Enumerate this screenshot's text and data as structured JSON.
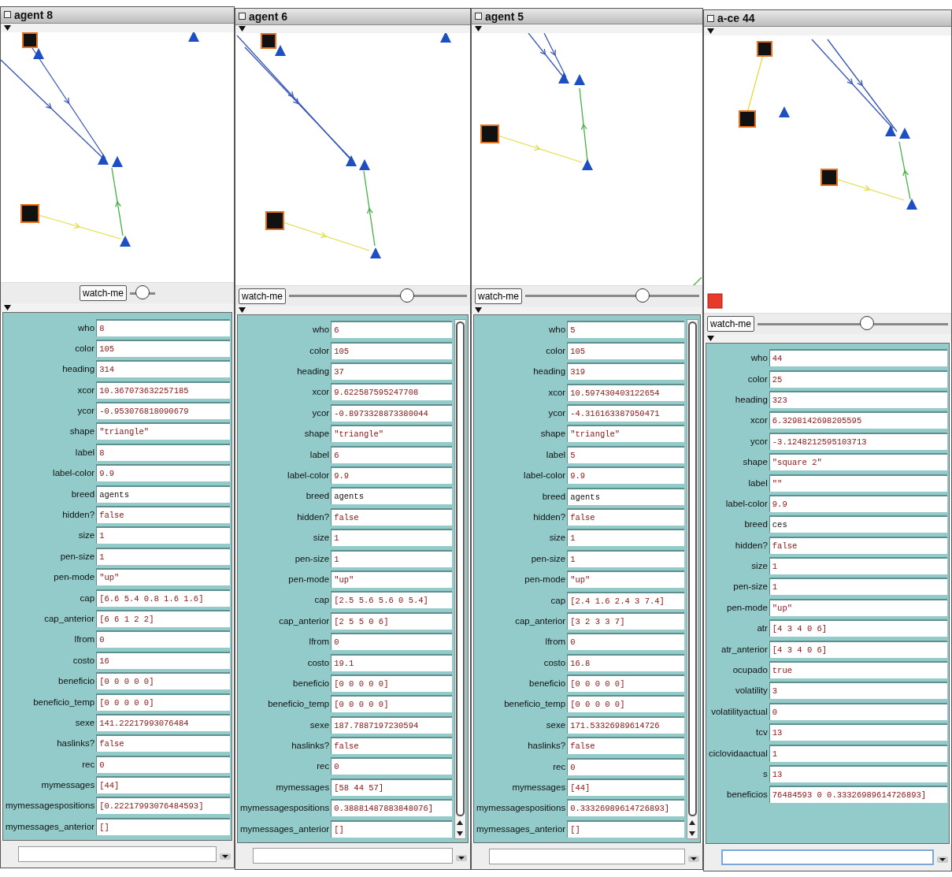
{
  "windows": [
    {
      "title": "agent 8",
      "watch_button": "watch-me",
      "slider": {
        "level": 0.5
      },
      "scrollable": false,
      "focused": false,
      "properties": [
        {
          "label": "who",
          "value": "8",
          "kind": "value"
        },
        {
          "label": "color",
          "value": "105",
          "kind": "value"
        },
        {
          "label": "heading",
          "value": "314",
          "kind": "value"
        },
        {
          "label": "xcor",
          "value": "10.367073632257185",
          "kind": "value"
        },
        {
          "label": "ycor",
          "value": "-0.953076818090679",
          "kind": "value"
        },
        {
          "label": "shape",
          "value": "\"triangle\"",
          "kind": "value"
        },
        {
          "label": "label",
          "value": "8",
          "kind": "value"
        },
        {
          "label": "label-color",
          "value": "9.9",
          "kind": "value"
        },
        {
          "label": "breed",
          "value": "agents",
          "kind": "breed"
        },
        {
          "label": "hidden?",
          "value": "false",
          "kind": "value"
        },
        {
          "label": "size",
          "value": "1",
          "kind": "value"
        },
        {
          "label": "pen-size",
          "value": "1",
          "kind": "value"
        },
        {
          "label": "pen-mode",
          "value": "\"up\"",
          "kind": "value"
        },
        {
          "label": "cap",
          "value": "[6.6 5.4 0.8 1.6 1.6]",
          "kind": "value"
        },
        {
          "label": "cap_anterior",
          "value": "[6 6 1 2 2]",
          "kind": "value"
        },
        {
          "label": "lfrom",
          "value": "0",
          "kind": "value"
        },
        {
          "label": "costo",
          "value": "16",
          "kind": "value"
        },
        {
          "label": "beneficio",
          "value": "[0 0 0 0 0]",
          "kind": "value"
        },
        {
          "label": "beneficio_temp",
          "value": "[0 0 0 0 0]",
          "kind": "value"
        },
        {
          "label": "sexe",
          "value": "141.22217993076484",
          "kind": "value"
        },
        {
          "label": "haslinks?",
          "value": "false",
          "kind": "value"
        },
        {
          "label": "rec",
          "value": "0",
          "kind": "value"
        },
        {
          "label": "mymessages",
          "value": "[44]",
          "kind": "value"
        },
        {
          "label": "mymessagespositions",
          "value": "[0.22217993076484593]",
          "kind": "value"
        },
        {
          "label": "mymessages_anterior",
          "value": "[]",
          "kind": "value"
        }
      ]
    },
    {
      "title": "agent 6",
      "watch_button": "watch-me",
      "slider": {
        "level": 0.68
      },
      "scrollable": true,
      "focused": false,
      "properties": [
        {
          "label": "who",
          "value": "6",
          "kind": "value"
        },
        {
          "label": "color",
          "value": "105",
          "kind": "value"
        },
        {
          "label": "heading",
          "value": "37",
          "kind": "value"
        },
        {
          "label": "xcor",
          "value": "9.622587595247708",
          "kind": "value"
        },
        {
          "label": "ycor",
          "value": "-0.8973328873380044",
          "kind": "value"
        },
        {
          "label": "shape",
          "value": "\"triangle\"",
          "kind": "value"
        },
        {
          "label": "label",
          "value": "6",
          "kind": "value"
        },
        {
          "label": "label-color",
          "value": "9.9",
          "kind": "value"
        },
        {
          "label": "breed",
          "value": "agents",
          "kind": "breed"
        },
        {
          "label": "hidden?",
          "value": "false",
          "kind": "value"
        },
        {
          "label": "size",
          "value": "1",
          "kind": "value"
        },
        {
          "label": "pen-size",
          "value": "1",
          "kind": "value"
        },
        {
          "label": "pen-mode",
          "value": "\"up\"",
          "kind": "value"
        },
        {
          "label": "cap",
          "value": "[2.5 5.6 5.6 0 5.4]",
          "kind": "value"
        },
        {
          "label": "cap_anterior",
          "value": "[2 5 5 0 6]",
          "kind": "value"
        },
        {
          "label": "lfrom",
          "value": "0",
          "kind": "value"
        },
        {
          "label": "costo",
          "value": "19.1",
          "kind": "value"
        },
        {
          "label": "beneficio",
          "value": "[0 0 0 0 0]",
          "kind": "value"
        },
        {
          "label": "beneficio_temp",
          "value": "[0 0 0 0 0]",
          "kind": "value"
        },
        {
          "label": "sexe",
          "value": "187.7887197230594",
          "kind": "value"
        },
        {
          "label": "haslinks?",
          "value": "false",
          "kind": "value"
        },
        {
          "label": "rec",
          "value": "0",
          "kind": "value"
        },
        {
          "label": "mymessages",
          "value": "[58 44 57]",
          "kind": "value"
        },
        {
          "label": "mymessagespositions",
          "value": "0.38881487883848076]",
          "kind": "value"
        },
        {
          "label": "mymessages_anterior",
          "value": "[]",
          "kind": "value"
        }
      ]
    },
    {
      "title": "agent 5",
      "watch_button": "watch-me",
      "slider": {
        "level": 0.69
      },
      "scrollable": true,
      "focused": false,
      "properties": [
        {
          "label": "who",
          "value": "5",
          "kind": "value"
        },
        {
          "label": "color",
          "value": "105",
          "kind": "value"
        },
        {
          "label": "heading",
          "value": "319",
          "kind": "value"
        },
        {
          "label": "xcor",
          "value": "10.597430403122654",
          "kind": "value"
        },
        {
          "label": "ycor",
          "value": "-4.316163387950471",
          "kind": "value"
        },
        {
          "label": "shape",
          "value": "\"triangle\"",
          "kind": "value"
        },
        {
          "label": "label",
          "value": "5",
          "kind": "value"
        },
        {
          "label": "label-color",
          "value": "9.9",
          "kind": "value"
        },
        {
          "label": "breed",
          "value": "agents",
          "kind": "breed"
        },
        {
          "label": "hidden?",
          "value": "false",
          "kind": "value"
        },
        {
          "label": "size",
          "value": "1",
          "kind": "value"
        },
        {
          "label": "pen-size",
          "value": "1",
          "kind": "value"
        },
        {
          "label": "pen-mode",
          "value": "\"up\"",
          "kind": "value"
        },
        {
          "label": "cap",
          "value": "[2.4 1.6 2.4 3 7.4]",
          "kind": "value"
        },
        {
          "label": "cap_anterior",
          "value": "[3 2 3 3 7]",
          "kind": "value"
        },
        {
          "label": "lfrom",
          "value": "0",
          "kind": "value"
        },
        {
          "label": "costo",
          "value": "16.8",
          "kind": "value"
        },
        {
          "label": "beneficio",
          "value": "[0 0 0 0 0]",
          "kind": "value"
        },
        {
          "label": "beneficio_temp",
          "value": "[0 0 0 0 0]",
          "kind": "value"
        },
        {
          "label": "sexe",
          "value": "171.53326989614726",
          "kind": "value"
        },
        {
          "label": "haslinks?",
          "value": "false",
          "kind": "value"
        },
        {
          "label": "rec",
          "value": "0",
          "kind": "value"
        },
        {
          "label": "mymessages",
          "value": "[44]",
          "kind": "value"
        },
        {
          "label": "mymessagespositions",
          "value": "0.33326989614726893]",
          "kind": "value"
        },
        {
          "label": "mymessages_anterior",
          "value": "[]",
          "kind": "value"
        }
      ]
    },
    {
      "title": "a-ce 44",
      "watch_button": "watch-me",
      "slider": {
        "level": 0.58
      },
      "scrollable": false,
      "focused": true,
      "properties": [
        {
          "label": "who",
          "value": "44",
          "kind": "value"
        },
        {
          "label": "color",
          "value": "25",
          "kind": "value"
        },
        {
          "label": "heading",
          "value": "323",
          "kind": "value"
        },
        {
          "label": "xcor",
          "value": "6.3298142698205595",
          "kind": "value"
        },
        {
          "label": "ycor",
          "value": "-3.1248212595103713",
          "kind": "value"
        },
        {
          "label": "shape",
          "value": "\"square 2\"",
          "kind": "value"
        },
        {
          "label": "label",
          "value": "\"\"",
          "kind": "value"
        },
        {
          "label": "label-color",
          "value": "9.9",
          "kind": "value"
        },
        {
          "label": "breed",
          "value": "ces",
          "kind": "breed"
        },
        {
          "label": "hidden?",
          "value": "false",
          "kind": "value"
        },
        {
          "label": "size",
          "value": "1",
          "kind": "value"
        },
        {
          "label": "pen-size",
          "value": "1",
          "kind": "value"
        },
        {
          "label": "pen-mode",
          "value": "\"up\"",
          "kind": "value"
        },
        {
          "label": "atr",
          "value": "[4 3 4 0 6]",
          "kind": "value"
        },
        {
          "label": "atr_anterior",
          "value": "[4 3 4 0 6]",
          "kind": "value"
        },
        {
          "label": "ocupado",
          "value": "true",
          "kind": "value"
        },
        {
          "label": "volatility",
          "value": "3",
          "kind": "value"
        },
        {
          "label": "volatilityactual",
          "value": "0",
          "kind": "value"
        },
        {
          "label": "tcv",
          "value": "13",
          "kind": "value"
        },
        {
          "label": "ciclovidaactual",
          "value": "1",
          "kind": "value"
        },
        {
          "label": "s",
          "value": "13",
          "kind": "value"
        },
        {
          "label": "beneficios",
          "value": "76484593 0 0.33326989614726893]",
          "kind": "value"
        }
      ]
    }
  ]
}
